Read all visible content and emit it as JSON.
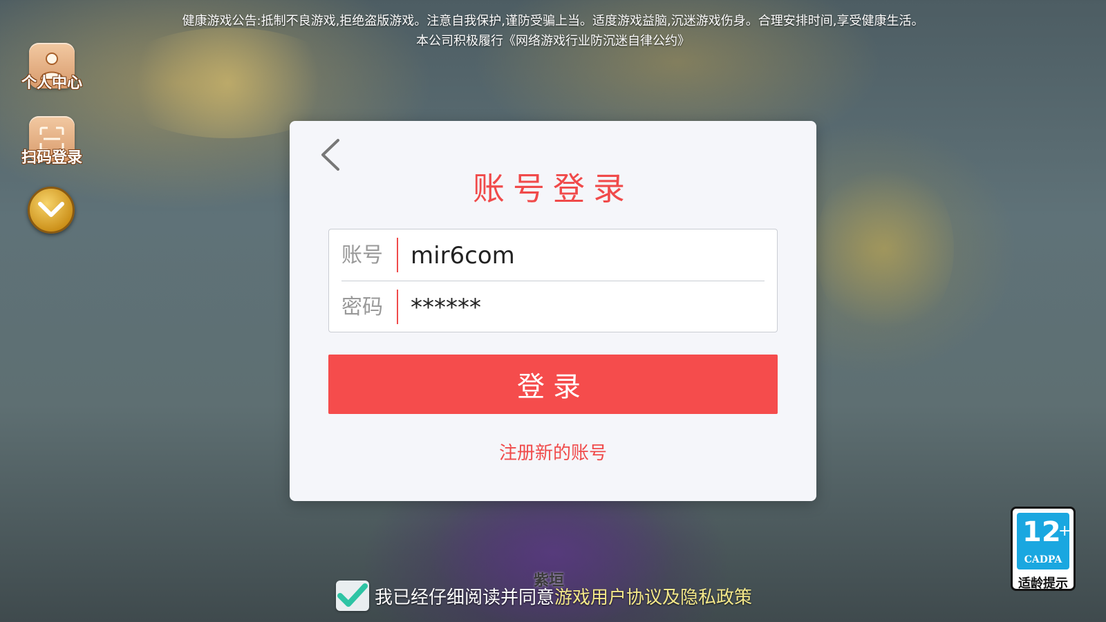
{
  "notice": {
    "line1": "健康游戏公告:抵制不良游戏,拒绝盗版游戏。注意自我保护,谨防受骗上当。适度游戏益脑,沉迷游戏伤身。合理安排时间,享受健康生活。",
    "line2": "本公司积极履行《网络游戏行业防沉迷自律公约》"
  },
  "sidebar": {
    "items": [
      {
        "label": "个人中心",
        "icon": "person-icon"
      },
      {
        "label": "扫码登录",
        "icon": "scan-icon"
      }
    ],
    "collapse_icon": "chevron-down-icon"
  },
  "login": {
    "title": "账号登录",
    "account_label": "账号",
    "account_value": "mir6com",
    "password_label": "密码",
    "password_value": "******",
    "submit_label": "登录",
    "register_link": "注册新的账号"
  },
  "agreement": {
    "checked": true,
    "text": "我已经仔细阅读并同意",
    "link": "游戏用户协议及隐私政策"
  },
  "character_name": "紫垣",
  "rating": {
    "age": "12",
    "plus": "+",
    "org": "CADPA",
    "tip": "适龄提示"
  },
  "colors": {
    "accent": "#f54c4c",
    "panel": "#f5f6fa",
    "rating_blue": "#1aa7e0",
    "agreement_link": "#f4e88a"
  }
}
